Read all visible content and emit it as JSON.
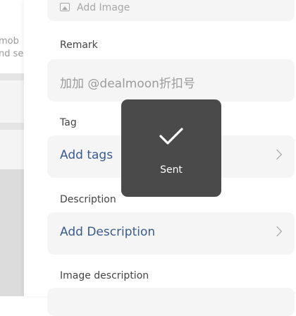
{
  "background": {
    "line1": "mob",
    "line2": "nd se"
  },
  "form": {
    "add_image_label": "Add Image",
    "remark_label": "Remark",
    "remark_placeholder": "加加 @dealmoon折扣号",
    "tag_label": "Tag",
    "tag_value": "Add tags",
    "description_label": "Description",
    "description_value": "Add Description",
    "image_description_label": "Image description"
  },
  "toast": {
    "text": "Sent",
    "icon": "checkmark-icon"
  }
}
